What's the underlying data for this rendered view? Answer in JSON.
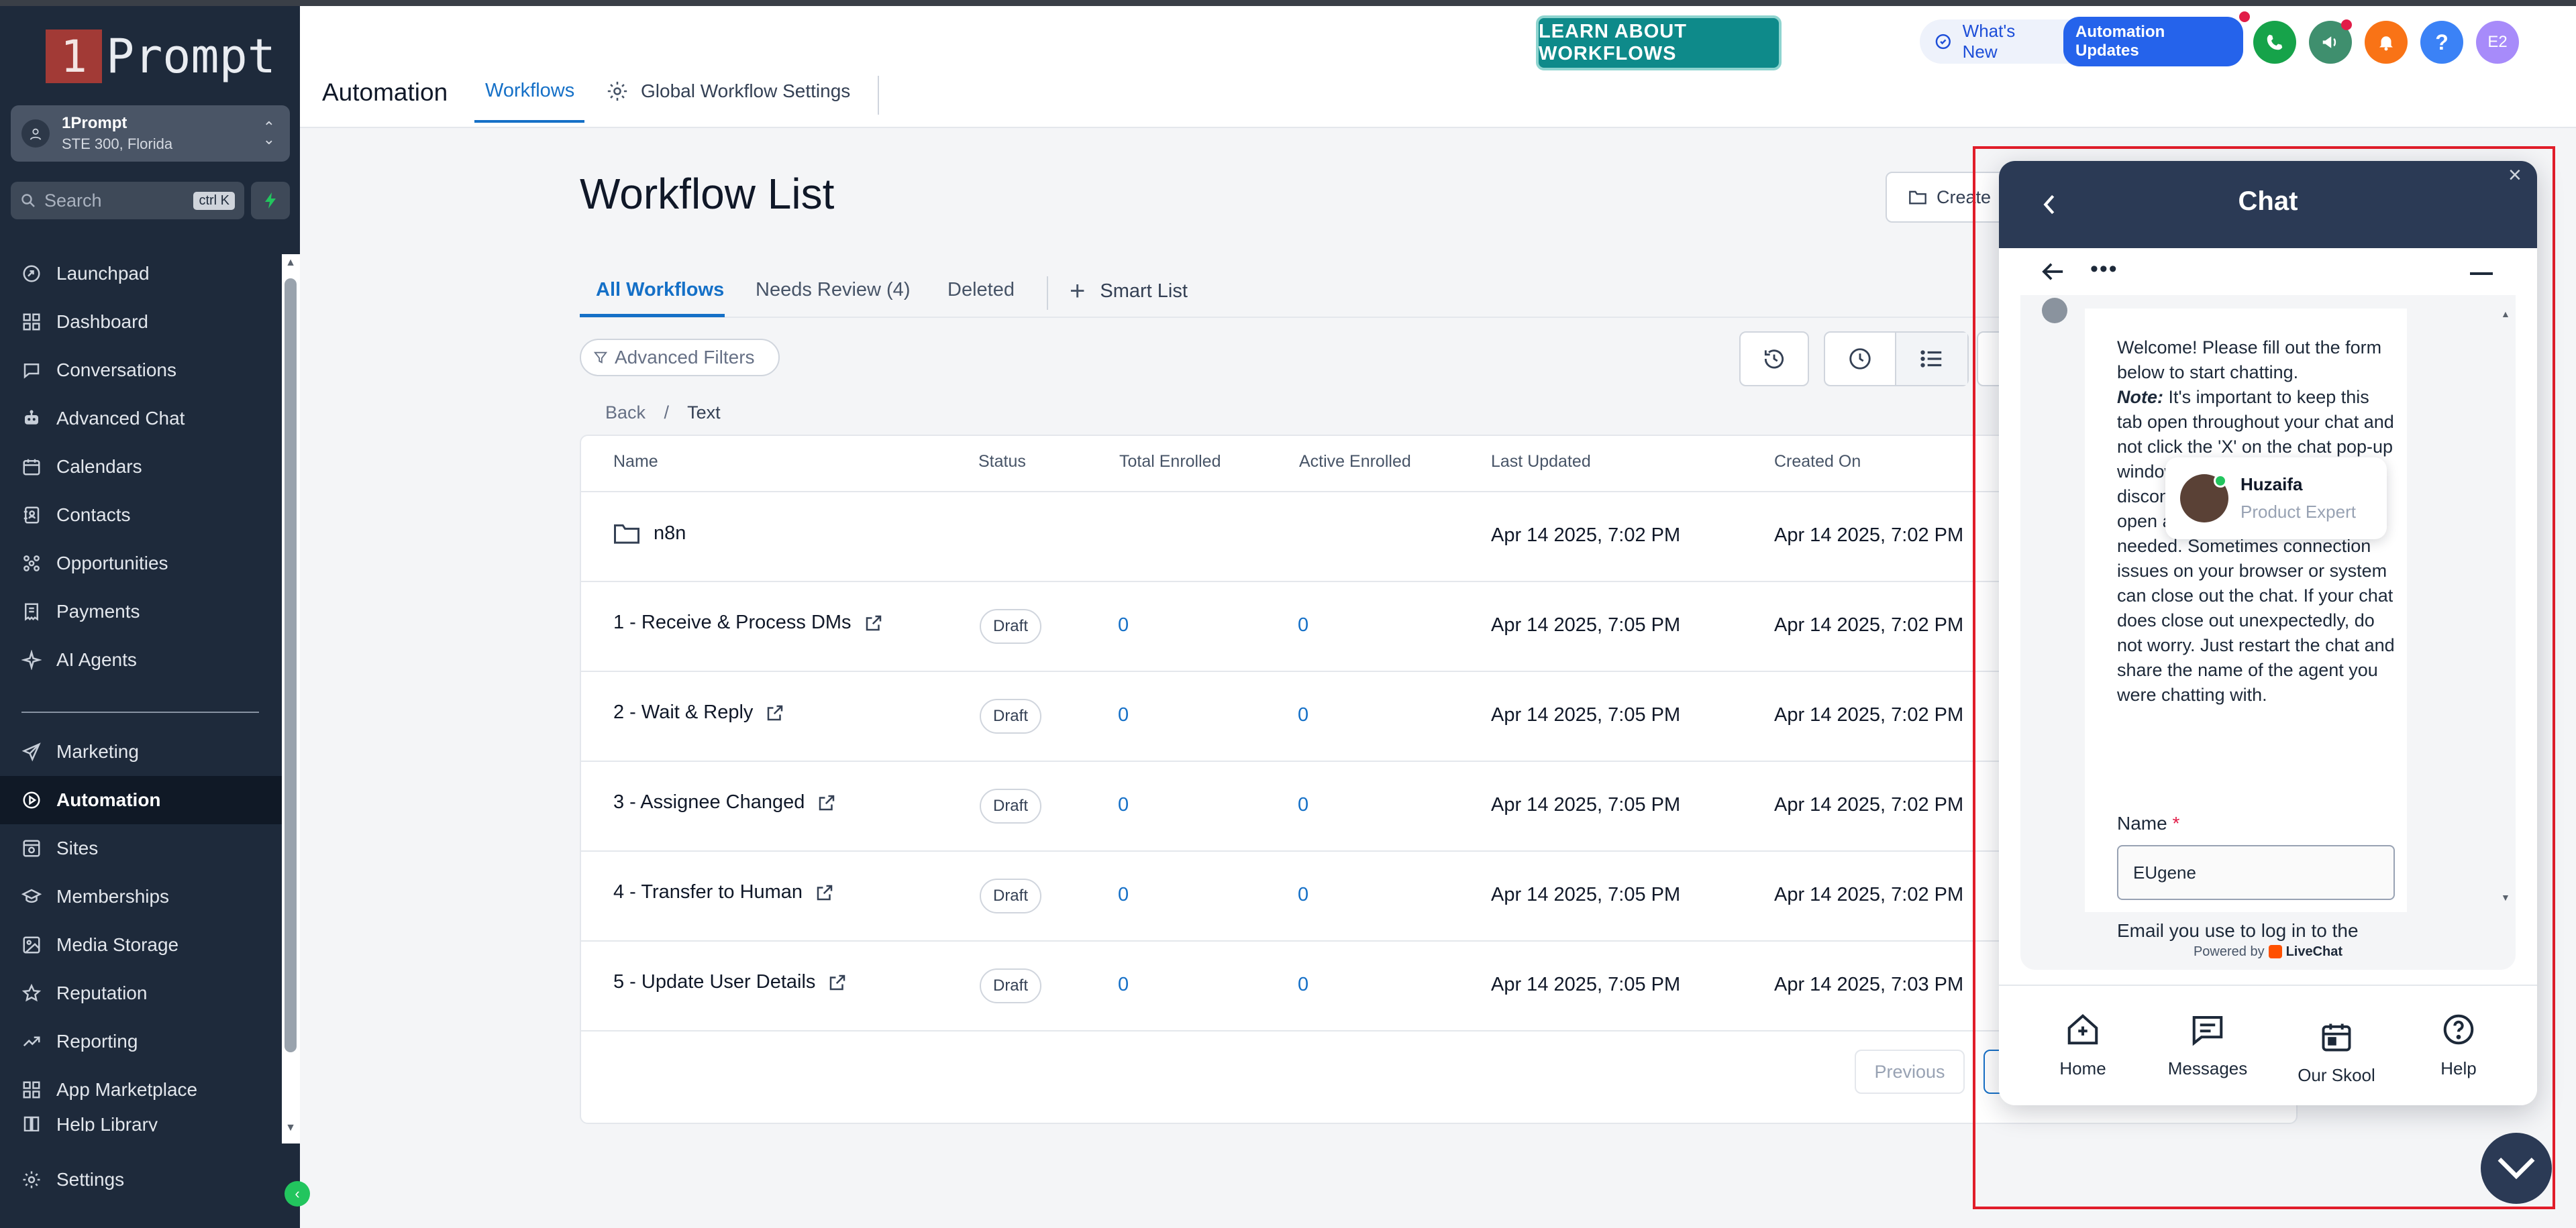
{
  "sidebar": {
    "logo_number": "1",
    "logo_word": "Prompt",
    "account": {
      "name": "1Prompt",
      "address": "STE 300, Florida"
    },
    "search": {
      "placeholder": "Search",
      "shortcut": "ctrl K"
    },
    "items": [
      {
        "label": "Launchpad",
        "icon": "launchpad-icon"
      },
      {
        "label": "Dashboard",
        "icon": "grid-icon"
      },
      {
        "label": "Conversations",
        "icon": "chat-bubble-icon"
      },
      {
        "label": "Advanced Chat",
        "icon": "robot-icon"
      },
      {
        "label": "Calendars",
        "icon": "calendar-icon"
      },
      {
        "label": "Contacts",
        "icon": "contacts-icon"
      },
      {
        "label": "Opportunities",
        "icon": "opportunities-icon"
      },
      {
        "label": "Payments",
        "icon": "receipt-icon"
      },
      {
        "label": "AI Agents",
        "icon": "sparkle-icon"
      }
    ],
    "items2": [
      {
        "label": "Marketing",
        "icon": "send-icon"
      },
      {
        "label": "Automation",
        "icon": "automation-icon",
        "active": true
      },
      {
        "label": "Sites",
        "icon": "sites-icon"
      },
      {
        "label": "Memberships",
        "icon": "memberships-icon"
      },
      {
        "label": "Media Storage",
        "icon": "image-icon"
      },
      {
        "label": "Reputation",
        "icon": "star-icon"
      },
      {
        "label": "Reporting",
        "icon": "trend-icon"
      },
      {
        "label": "App Marketplace",
        "icon": "apps-icon"
      },
      {
        "label": "Help Library",
        "icon": "book-icon"
      }
    ],
    "settings_label": "Settings"
  },
  "header": {
    "title": "Automation",
    "tabs": [
      {
        "label": "Workflows",
        "active": true
      },
      {
        "label": "Global Workflow Settings"
      }
    ],
    "learn_button": "LEARN ABOUT WORKFLOWS",
    "whats_new": "What's New",
    "updates_badge": "Automation Updates",
    "avatar_initials": "E2",
    "help_glyph": "?"
  },
  "main": {
    "title": "Workflow List",
    "create_label": "Create",
    "subtabs": [
      {
        "label": "All Workflows",
        "active": true
      },
      {
        "label": "Needs Review (4)"
      },
      {
        "label": "Deleted"
      }
    ],
    "smart_list": "Smart List",
    "advanced_filters": "Advanced Filters",
    "breadcrumb": {
      "back": "Back",
      "sep": "/",
      "current": "Text"
    },
    "columns": [
      "Name",
      "Status",
      "Total Enrolled",
      "Active Enrolled",
      "Last Updated",
      "Created On"
    ],
    "rows": [
      {
        "name": "n8n",
        "folder": true,
        "status": "",
        "total": "",
        "active": "",
        "updated": "Apr 14 2025, 7:02 PM",
        "created": "Apr 14 2025, 7:02 PM"
      },
      {
        "name": "1 - Receive & Process DMs",
        "status": "Draft",
        "total": "0",
        "active": "0",
        "updated": "Apr 14 2025, 7:05 PM",
        "created": "Apr 14 2025, 7:02 PM"
      },
      {
        "name": "2 - Wait & Reply",
        "status": "Draft",
        "total": "0",
        "active": "0",
        "updated": "Apr 14 2025, 7:05 PM",
        "created": "Apr 14 2025, 7:02 PM"
      },
      {
        "name": "3 - Assignee Changed",
        "status": "Draft",
        "total": "0",
        "active": "0",
        "updated": "Apr 14 2025, 7:05 PM",
        "created": "Apr 14 2025, 7:02 PM"
      },
      {
        "name": "4 - Transfer to Human",
        "status": "Draft",
        "total": "0",
        "active": "0",
        "updated": "Apr 14 2025, 7:05 PM",
        "created": "Apr 14 2025, 7:02 PM"
      },
      {
        "name": "5 - Update User Details",
        "status": "Draft",
        "total": "0",
        "active": "0",
        "updated": "Apr 14 2025, 7:05 PM",
        "created": "Apr 14 2025, 7:03 PM"
      }
    ],
    "pager_previous": "Previous"
  },
  "chat": {
    "title": "Chat",
    "agent": {
      "name": "Huzaifa",
      "role": "Product Expert"
    },
    "message_lines": [
      "Welcome! Please fill out the form below to",
      "start chatting."
    ],
    "note_label": "Note:",
    "note_text": "It's important to keep this tab open throughout your chat and not click the 'X' on the chat pop-up window to avoid accidental disconnection. You can always open additional tabs separately if needed. Sometimes connection issues on your browser or system can close out the chat. If your chat does close out unexpectedly, do not worry. Just restart the chat and share the name of the agent you were chatting with.",
    "name_label": "Name",
    "name_value": "EUgene",
    "email_label": "Email you use to log in to the account",
    "required_mark": "*",
    "powered_by": "Powered by",
    "powered_brand": "LiveChat",
    "nav": [
      {
        "label": "Home",
        "icon": "home-plus-icon"
      },
      {
        "label": "Messages",
        "icon": "message-icon"
      },
      {
        "label": "Our Skool",
        "icon": "calendar-icon"
      },
      {
        "label": "Help",
        "icon": "help-circle-icon"
      }
    ]
  },
  "colors": {
    "sidebar_bg": "#1e2a3b",
    "accent": "#1570c7",
    "learn_bg": "#0e8a8a",
    "chat_header": "#2b3a55",
    "highlight": "#e11d2a"
  }
}
